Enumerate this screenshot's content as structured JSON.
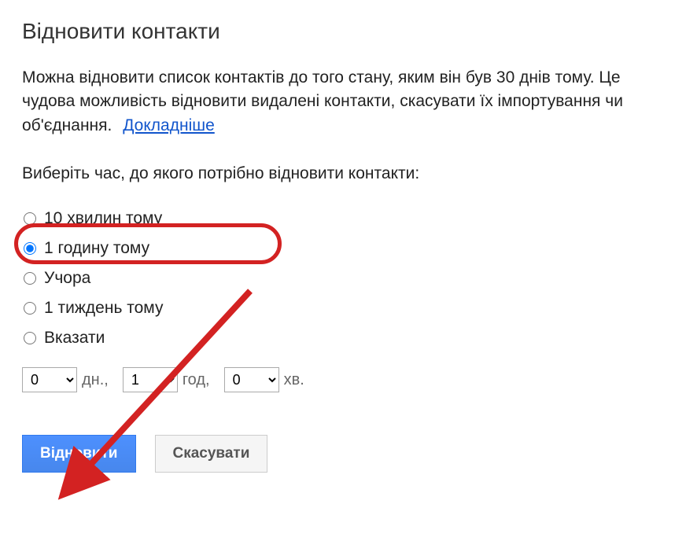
{
  "title": "Відновити контакти",
  "description": "Можна відновити список контактів до того стану, яким він був 30 днів тому. Це чудова можливість відновити видалені контакти, скасувати їх імпортування чи об'єднання.",
  "link_label": "Докладніше",
  "select_time_label": "Виберіть час, до якого потрібно відновити контакти:",
  "radios": {
    "opt0": "10 хвилин тому",
    "opt1": "1 годину тому",
    "opt2": "Учора",
    "opt3": "1 тиждень тому",
    "opt4": "Вказати",
    "selected_index": 1
  },
  "custom_time": {
    "days_value": "0",
    "days_unit": "дн.,",
    "hours_value": "1",
    "hours_unit": "год,",
    "minutes_value": "0",
    "minutes_unit": "хв."
  },
  "buttons": {
    "primary": "Відновити",
    "secondary": "Скасувати"
  },
  "annotation": {
    "highlight_color": "#d32222"
  }
}
